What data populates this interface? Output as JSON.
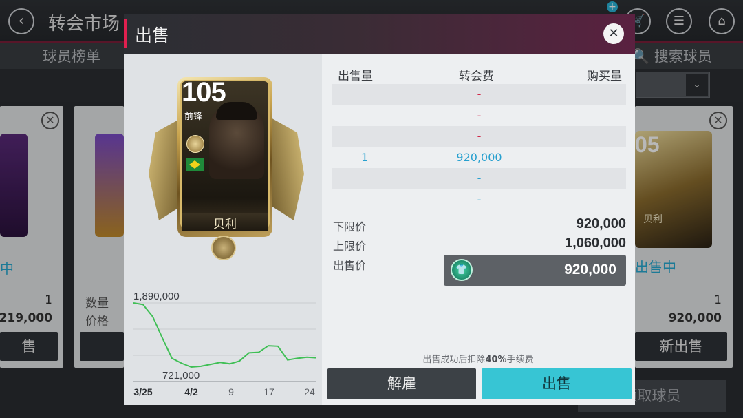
{
  "app": {
    "title": "转会市场",
    "nav_left": "球员榜单",
    "nav_right": "搜索球员",
    "claim_button": "领取球员"
  },
  "background_cards": {
    "left": {
      "status": "中",
      "qty_label": "数量",
      "price_label": "价格",
      "qty": "1",
      "price": "219,000",
      "button": "售"
    },
    "right": {
      "status": "出售中",
      "qty": "1",
      "price": "920,000",
      "button": "新出售",
      "rating_partial": "05",
      "name": "贝利"
    }
  },
  "modal": {
    "title": "出售",
    "close_icon": "close-icon",
    "player": {
      "rating": "105",
      "position": "前锋",
      "name": "贝利",
      "nation": "brazil-flag"
    },
    "table": {
      "headers": [
        "出售量",
        "转会费",
        "购买量"
      ],
      "rows": [
        {
          "qty": "",
          "fee": "-",
          "buy": "",
          "fee_color": "red"
        },
        {
          "qty": "",
          "fee": "-",
          "buy": "",
          "fee_color": "red"
        },
        {
          "qty": "",
          "fee": "-",
          "buy": "",
          "fee_color": "red"
        },
        {
          "qty": "1",
          "fee": "920,000",
          "buy": "",
          "fee_color": "blue"
        },
        {
          "qty": "",
          "fee": "-",
          "buy": "",
          "fee_color": "blue"
        },
        {
          "qty": "",
          "fee": "-",
          "buy": "",
          "fee_color": "blue"
        }
      ]
    },
    "lower_label": "下限价",
    "lower_value": "920,000",
    "upper_label": "上限价",
    "upper_value": "1,060,000",
    "sell_price_label": "出售价",
    "sell_price_value": "920,000",
    "fee_note_prefix": "出售成功后扣除",
    "fee_note_pct": "40%",
    "fee_note_suffix": "手续费",
    "dismiss_button": "解雇",
    "sell_button": "出售"
  },
  "chart_data": {
    "type": "line",
    "max_label": "1,890,000",
    "min_label": "721,000",
    "x_ticks": [
      "3/25",
      "4/2",
      "9",
      "17",
      "24"
    ],
    "series": [
      {
        "values": [
          1890000,
          1860000,
          1640000,
          1250000,
          880000,
          790000,
          721000,
          735000,
          770000,
          805000,
          780000,
          830000,
          980000,
          990000,
          1110000,
          1100000,
          850000,
          880000,
          900000,
          890000
        ]
      }
    ],
    "ylim": [
      721000,
      1890000
    ],
    "color": "#3fbf55"
  }
}
